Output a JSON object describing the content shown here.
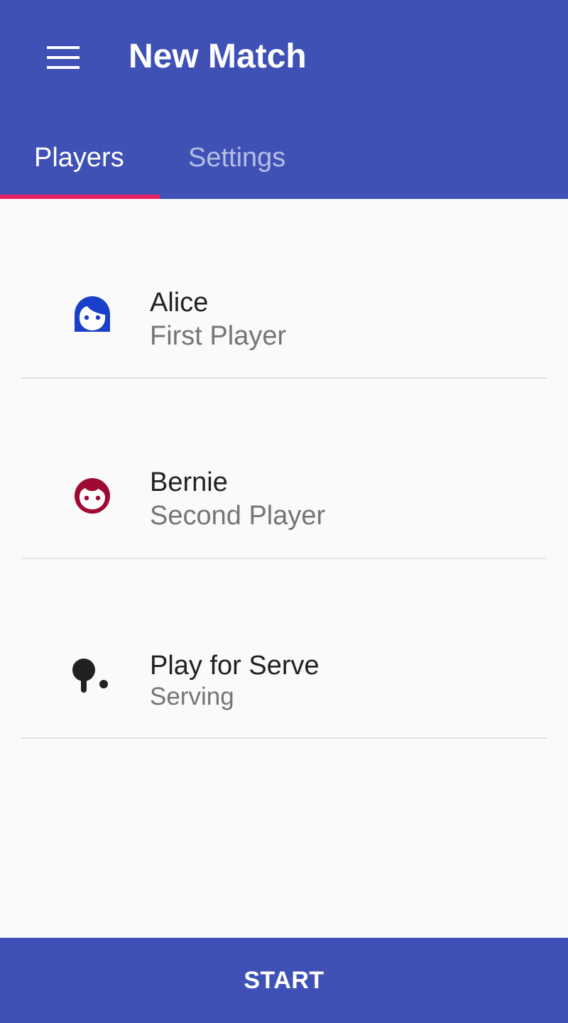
{
  "colors": {
    "primary": "#3f51b5",
    "accent": "#e91e63",
    "player1": "#1a3fc8",
    "player2": "#9e0a32",
    "serve_icon": "#212121"
  },
  "appbar": {
    "menu_icon": "hamburger-menu-icon",
    "title": "New Match"
  },
  "tabs": [
    {
      "label": "Players",
      "selected": true
    },
    {
      "label": "Settings",
      "selected": false
    }
  ],
  "players": [
    {
      "name": "Alice",
      "role": "First Player",
      "icon": "female-face-icon"
    },
    {
      "name": "Bernie",
      "role": "Second Player",
      "icon": "male-face-icon"
    }
  ],
  "serve": {
    "title": "Play for Serve",
    "value": "Serving",
    "icon": "ping-pong-paddle-icon"
  },
  "start_button": {
    "label": "START"
  }
}
